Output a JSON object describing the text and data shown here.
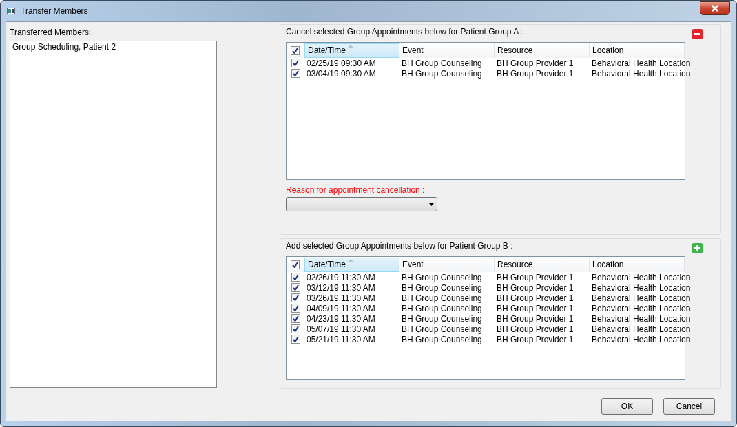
{
  "window": {
    "title": "Transfer Members"
  },
  "members": {
    "label": "Transferred Members:",
    "items": [
      "Group Scheduling, Patient 2"
    ]
  },
  "cancel_group": {
    "title": "Cancel selected Group Appointments below for Patient Group A :",
    "kind": "remove",
    "all_checked": true,
    "columns": [
      {
        "label": "Date/Time",
        "sorted": true
      },
      {
        "label": "Event",
        "sorted": false
      },
      {
        "label": "Resource",
        "sorted": false
      },
      {
        "label": "Location",
        "sorted": false
      }
    ],
    "rows": [
      {
        "checked": true,
        "cells": [
          "02/25/19 09:30 AM",
          "BH Group Counseling",
          "BH Group Provider 1",
          "Behavioral Health Location"
        ]
      },
      {
        "checked": true,
        "cells": [
          "03/04/19 09:30 AM",
          "BH Group Counseling",
          "BH Group Provider 1",
          "Behavioral Health Location"
        ]
      }
    ],
    "reason": {
      "label": "Reason for appointment cancellation :"
    }
  },
  "add_group": {
    "title": "Add selected Group Appointments below for Patient Group B :",
    "kind": "add",
    "all_checked": true,
    "columns": [
      {
        "label": "Date/Time",
        "sorted": true
      },
      {
        "label": "Event",
        "sorted": false
      },
      {
        "label": "Resource",
        "sorted": false
      },
      {
        "label": "Location",
        "sorted": false
      }
    ],
    "rows": [
      {
        "checked": true,
        "cells": [
          "02/26/19 11:30 AM",
          "BH Group Counseling",
          "BH Group Provider 1",
          "Behavioral Health Location"
        ]
      },
      {
        "checked": true,
        "cells": [
          "03/12/19 11:30 AM",
          "BH Group Counseling",
          "BH Group Provider 1",
          "Behavioral Health Location"
        ]
      },
      {
        "checked": true,
        "cells": [
          "03/26/19 11:30 AM",
          "BH Group Counseling",
          "BH Group Provider 1",
          "Behavioral Health Location"
        ]
      },
      {
        "checked": true,
        "cells": [
          "04/09/19 11:30 AM",
          "BH Group Counseling",
          "BH Group Provider 1",
          "Behavioral Health Location"
        ]
      },
      {
        "checked": true,
        "cells": [
          "04/23/19 11:30 AM",
          "BH Group Counseling",
          "BH Group Provider 1",
          "Behavioral Health Location"
        ]
      },
      {
        "checked": true,
        "cells": [
          "05/07/19 11:30 AM",
          "BH Group Counseling",
          "BH Group Provider 1",
          "Behavioral Health Location"
        ]
      },
      {
        "checked": true,
        "cells": [
          "05/21/19 11:30 AM",
          "BH Group Counseling",
          "BH Group Provider 1",
          "Behavioral Health Location"
        ]
      }
    ]
  },
  "buttons": [
    "OK",
    "Cancel"
  ]
}
